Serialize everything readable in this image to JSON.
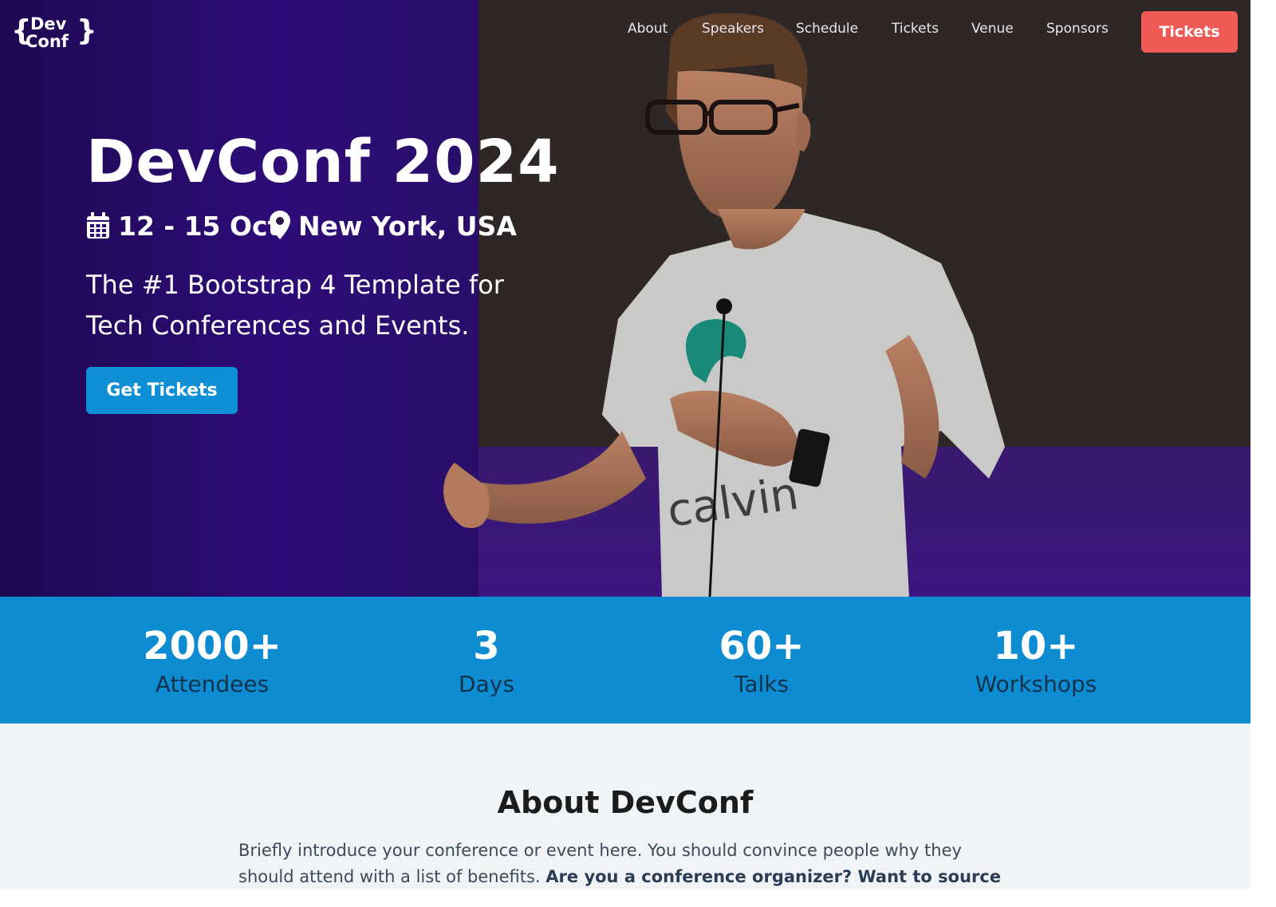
{
  "brand": {
    "line1": "Dev",
    "line2": "Conf"
  },
  "nav": {
    "items": [
      "About",
      "Speakers",
      "Schedule",
      "Tickets",
      "Venue",
      "Sponsors"
    ],
    "cta": "Tickets"
  },
  "hero": {
    "title": "DevConf 2024",
    "date": "12 - 15 Oct",
    "location": "New York, USA",
    "tagline_line1": "The #1 Bootstrap 4 Template for",
    "tagline_line2": "Tech Conferences and Events.",
    "button": "Get Tickets",
    "icons": {
      "date": "calendar-icon",
      "location": "map-pin-icon"
    }
  },
  "stats": [
    {
      "value": "2000+",
      "label": "Attendees"
    },
    {
      "value": "3",
      "label": "Days"
    },
    {
      "value": "60+",
      "label": "Talks"
    },
    {
      "value": "10+",
      "label": "Workshops"
    }
  ],
  "about": {
    "title": "About DevConf",
    "text_plain": "Briefly introduce your conference or event here. You should convince people why they should attend with a list of benefits.",
    "text_bold": "Are you a conference organizer? Want to source developer t-shirts as part of"
  },
  "colors": {
    "accent": "#0e8cd2",
    "cta": "#ef5a57",
    "hero_purple": "#2e0c78"
  }
}
